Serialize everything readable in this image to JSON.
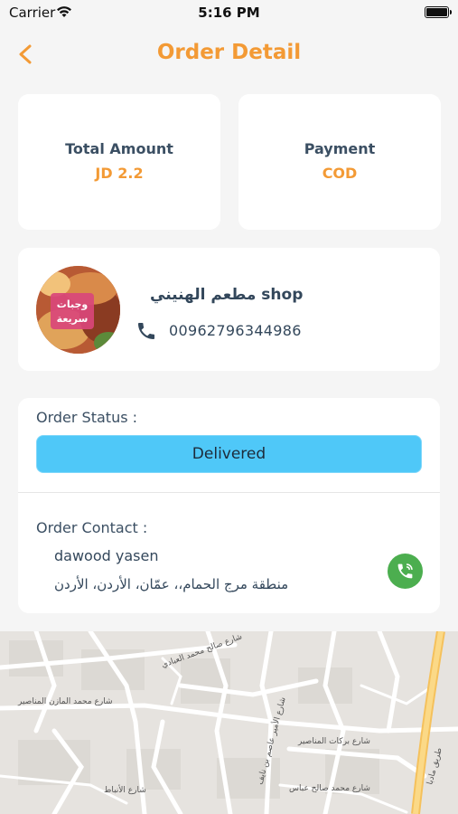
{
  "status_bar": {
    "carrier": "Carrier",
    "time": "5:16 PM"
  },
  "header": {
    "title": "Order Detail",
    "back_icon": "chevron-left-icon"
  },
  "summary": {
    "total_amount_label": "Total Amount",
    "total_amount_value": "JD 2.2",
    "payment_label": "Payment",
    "payment_value": "COD"
  },
  "shop": {
    "avatar_text_line1": "وجبات",
    "avatar_text_line2": "سريعة",
    "name": "مطعم الهنيني shop",
    "phone": "00962796344986"
  },
  "order": {
    "status_label": "Order Status :",
    "status_value": "Delivered",
    "contact_label": "Order Contact :",
    "contact_name": "dawood yasen",
    "contact_address": "منطقة مرج الحمام،، عمّان، الأردن، الأردن"
  },
  "map": {
    "labels": [
      "شارع محمد المازن المناصير",
      "شارع بركات المناصير",
      "شارع محمد صالح عباس",
      "شارع صالح محمد العبادي",
      "شارع الأمير عاصم بن نايف",
      "شارع الأنباط",
      "طريق مادبا"
    ]
  },
  "colors": {
    "accent": "#f39a35",
    "status_delivered": "#4fc8f8",
    "call_green": "#4cae4f",
    "background": "#f5f5f5"
  }
}
